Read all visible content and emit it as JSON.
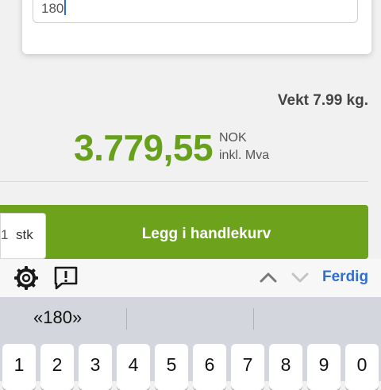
{
  "search": {
    "value": "180"
  },
  "product": {
    "weight_label": "Vekt 7.99 kg.",
    "price": "3.779,55",
    "currency": "NOK",
    "vat_note": "inkl. Mva"
  },
  "cart": {
    "quantity": "1",
    "unit": "stk",
    "add_label": "Legg i handlekurv"
  },
  "keyboard": {
    "done_label": "Ferdig",
    "suggestion": "«180»",
    "keys": [
      "1",
      "2",
      "3",
      "4",
      "5",
      "6",
      "7",
      "8",
      "9",
      "0"
    ]
  },
  "colors": {
    "accent_green": "#67a11c",
    "button_green": "#6da21d",
    "link_blue": "#2f6fd0"
  },
  "icons": {
    "settings": "gear-icon",
    "feedback": "feedback-icon",
    "previous": "chevron-up-icon",
    "next": "chevron-down-icon"
  }
}
